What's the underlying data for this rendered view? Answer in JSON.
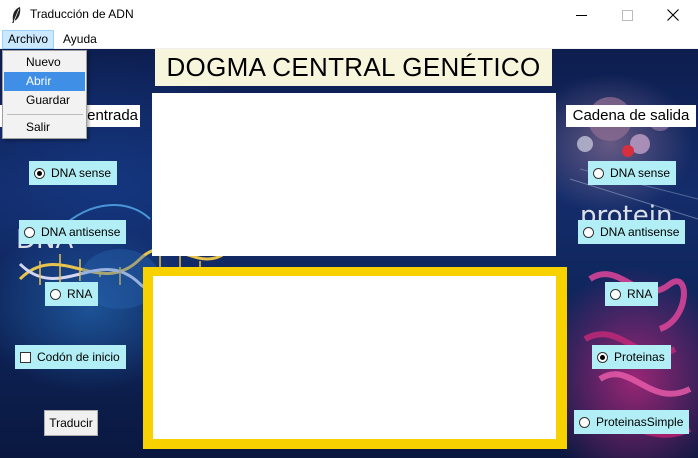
{
  "window": {
    "title": "Traducción de ADN"
  },
  "menubar": {
    "items": [
      "Archivo",
      "Ayuda"
    ]
  },
  "dropdown": {
    "items": [
      "Nuevo",
      "Abrir",
      "Guardar",
      "Salir"
    ],
    "hovered": "Abrir"
  },
  "main": {
    "header": "DOGMA CENTRAL GENÉTICO",
    "input_label": "Cadena de entrada",
    "output_label": "Cadena de salida",
    "input_text": "",
    "output_text": "",
    "background_words": {
      "dna": "DNA",
      "protein": "protein"
    }
  },
  "input_options": [
    {
      "label": "DNA sense",
      "selected": true
    },
    {
      "label": "DNA antisense",
      "selected": false
    },
    {
      "label": "RNA",
      "selected": false
    }
  ],
  "start_codon": {
    "label": "Codón de inicio",
    "checked": false
  },
  "translate_button": "Traducir",
  "output_options": [
    {
      "label": "DNA sense",
      "selected": false
    },
    {
      "label": "DNA antisense",
      "selected": false
    },
    {
      "label": "RNA",
      "selected": false
    },
    {
      "label": "Proteinas",
      "selected": true
    },
    {
      "label": "ProteinasSimple",
      "selected": false
    }
  ],
  "colors": {
    "radio_bg": "#b2eef5",
    "output_border": "#f8d100",
    "header_bg": "#f7f5dc",
    "menu_highlight": "#3f8fe6"
  }
}
